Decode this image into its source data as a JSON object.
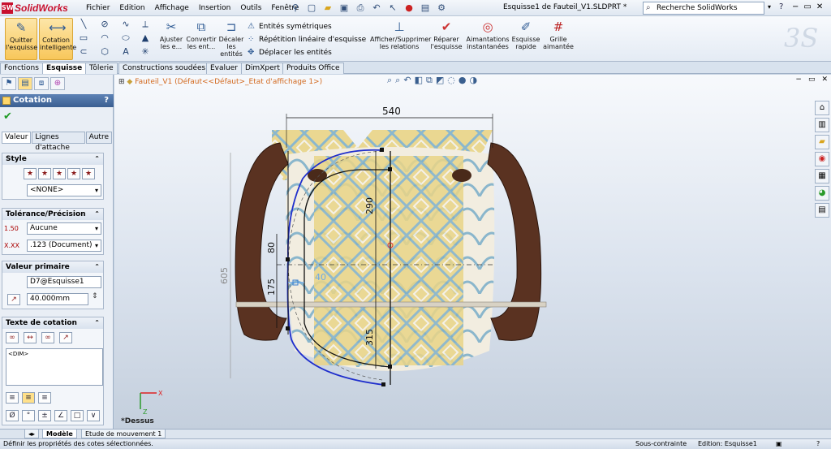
{
  "app": {
    "logo": "SolidWorks",
    "logo_mark": "SW"
  },
  "menu": [
    "Fichier",
    "Edition",
    "Affichage",
    "Insertion",
    "Outils",
    "Fenêtre"
  ],
  "window": {
    "title": "Esquisse1 de Fauteil_V1.SLDPRT *"
  },
  "search": {
    "placeholder": "Recherche SolidWorks"
  },
  "commands": {
    "exit_sketch": "Quitter l'esquisse",
    "smart_dim": "Cotation intelligente",
    "trim": "Ajuster les e...",
    "convert": "Convertir les ent...",
    "offset": "Décaler les entités",
    "mirror": "Entités symétriques",
    "linear_pattern": "Répétition linéaire d'esquisse",
    "move": "Déplacer les entités",
    "relations": "Afficher/Supprimer les relations",
    "repair": "Réparer l'esquisse",
    "quick_snaps": "Aimantations instantanées",
    "rapid_sketch": "Esquisse rapide",
    "grid": "Grille aimantée"
  },
  "tabs": [
    "Fonctions",
    "Esquisse",
    "Tôlerie",
    "Constructions soudées",
    "Evaluer",
    "DimXpert",
    "Produits Office"
  ],
  "active_tab": "Esquisse",
  "feature_tree": {
    "item": "Fauteil_V1",
    "config": "(Défaut<<Défaut>_Etat d'affichage 1>)"
  },
  "panel": {
    "title": "Cotation",
    "help": "?",
    "subtabs": [
      "Valeur",
      "Lignes d'attache",
      "Autre"
    ],
    "style": {
      "header": "Style",
      "value": "<NONE>"
    },
    "tolerance": {
      "header": "Tolérance/Précision",
      "type": "Aucune",
      "precision": ".123 (Document)",
      "icon1": "1.50",
      "icon2": "X.XX"
    },
    "primary": {
      "header": "Valeur primaire",
      "name": "D7@Esquisse1",
      "value": "40.000mm"
    },
    "dim_text": {
      "header": "Texte de cotation",
      "content": "<DIM>"
    },
    "symbols": [
      "Ø",
      "°",
      "±",
      "∠",
      "□",
      "∨"
    ]
  },
  "drawing": {
    "dims": [
      "540",
      "605",
      "290",
      "80",
      "175",
      "40",
      "315"
    ],
    "view": "*Dessus",
    "axis_x": "X",
    "axis_z": "Z"
  },
  "bottom_tabs": [
    "Modèle",
    "Etude de mouvement 1"
  ],
  "status": {
    "message": "Définir les propriétés des cotes sélectionnées.",
    "state": "Sous-contrainte",
    "edit": "Edition: Esquisse1"
  },
  "colors": {
    "accent": "#3b5f91",
    "sketch_blue": "#1f2ecc",
    "dim_selected": "#6aa9e8"
  }
}
